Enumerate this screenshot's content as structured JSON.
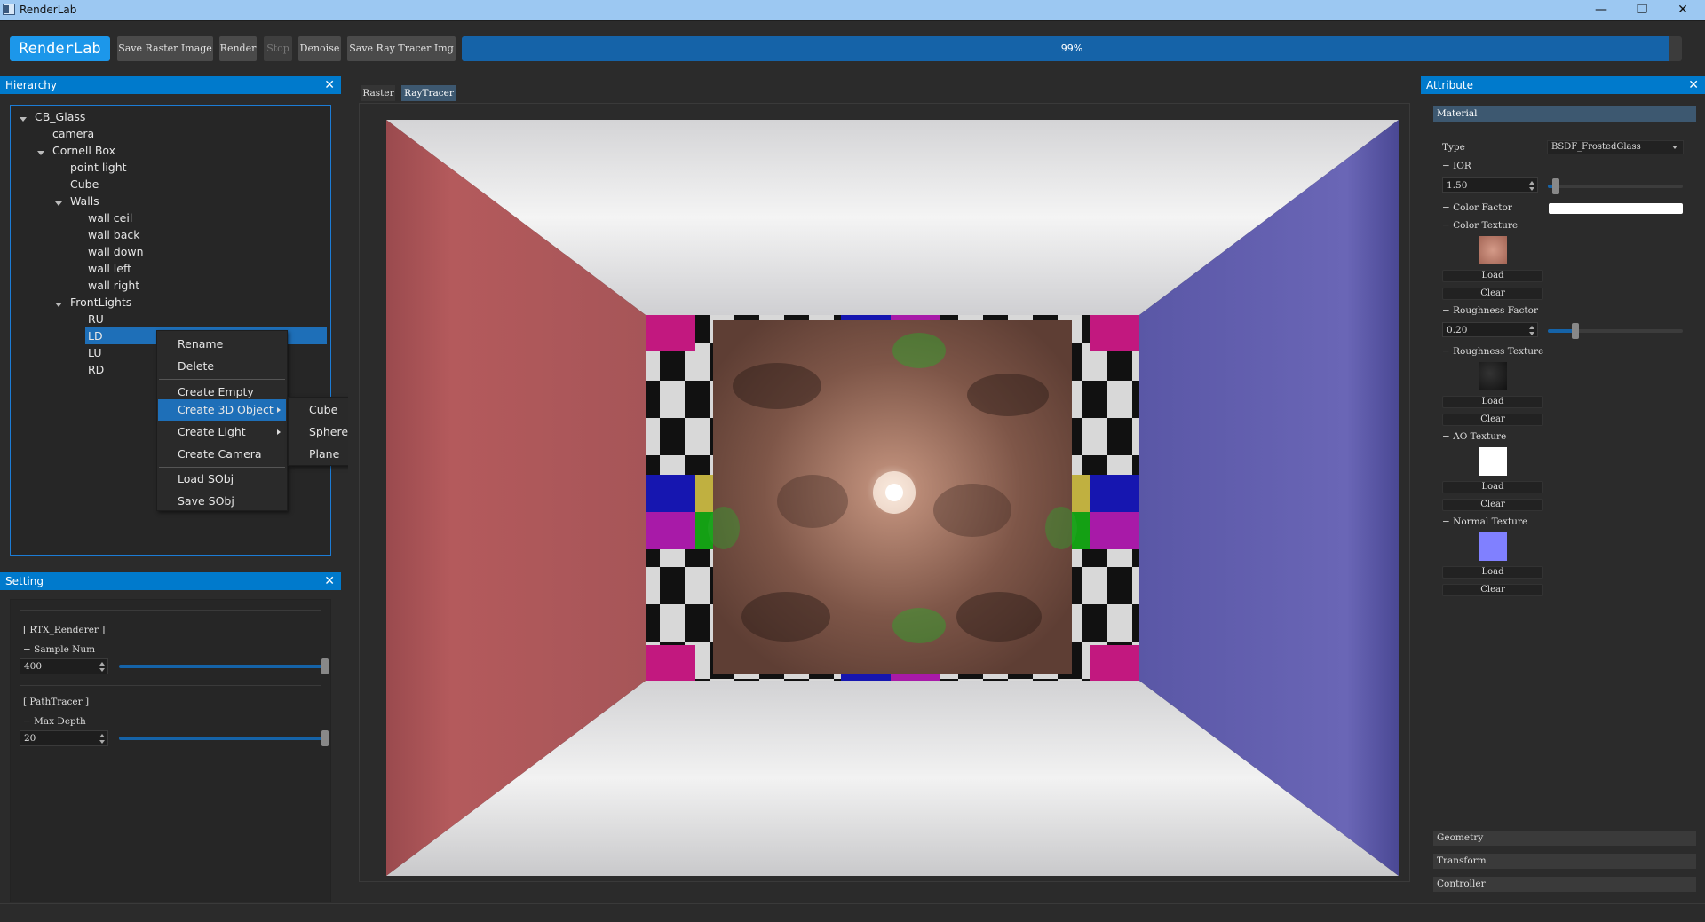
{
  "window": {
    "title": "RenderLab",
    "minimize": "—",
    "maximize": "❐",
    "close": "✕"
  },
  "toolbar": {
    "brand": "RenderLab",
    "buttons": [
      "Save Raster Image",
      "Render",
      "Stop",
      "Denoise",
      "Save Ray Tracer Img"
    ],
    "progress_text": "99%",
    "progress_value": 0.99
  },
  "hierarchy": {
    "title": "Hierarchy",
    "close": "✕",
    "nodes": [
      "CB_Glass",
      "camera",
      "Cornell Box",
      "point light",
      "Cube",
      "Walls",
      "wall ceil",
      "wall back",
      "wall down",
      "wall left",
      "wall right",
      "FrontLights",
      "RU",
      "LD",
      "LU",
      "RD"
    ]
  },
  "context_menu": {
    "items": [
      "Rename",
      "Delete",
      "Create Empty",
      "Create 3D Object",
      "Create Light",
      "Create Camera",
      "Load SObj",
      "Save SObj"
    ],
    "submenu": [
      "Cube",
      "Sphere",
      "Plane"
    ]
  },
  "setting": {
    "title": "Setting",
    "close": "✕",
    "rtx_header": "[ RTX_Renderer ]",
    "sample_label": "− Sample Num",
    "sample_value": "400",
    "path_header": "[ PathTracer ]",
    "depth_label": "− Max Depth",
    "depth_value": "20"
  },
  "viewport": {
    "tabs": [
      "Raster",
      "RayTracer"
    ],
    "active_tab": "RayTracer"
  },
  "attribute": {
    "title": "Attribute",
    "close": "✕",
    "material_header": "Material",
    "type_label": "Type",
    "type_value": "BSDF_FrostedGlass",
    "ior_label": "− IOR",
    "ior_value": "1.50",
    "color_factor_label": "− Color Factor",
    "color_texture_label": "− Color Texture",
    "roughness_factor_label": "− Roughness Factor",
    "roughness_value": "0.20",
    "roughness_texture_label": "− Roughness Texture",
    "ao_texture_label": "− AO Texture",
    "normal_texture_label": "− Normal Texture",
    "load": "Load",
    "clear": "Clear",
    "geometry": "Geometry",
    "transform": "Transform",
    "controller": "Controller"
  },
  "colors": {
    "accent": "#007acc",
    "selection": "#1e6fb8",
    "left_wall": "#b45a5c",
    "right_wall": "#6a66b6",
    "normal_tex": "#8080ff"
  }
}
